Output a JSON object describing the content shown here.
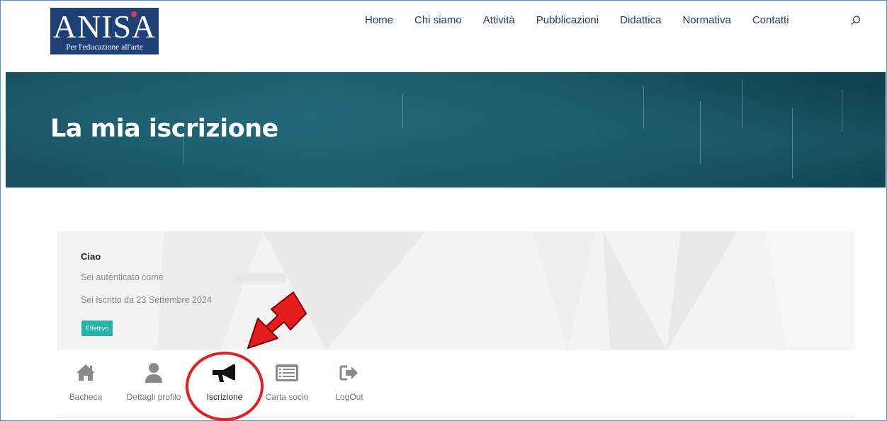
{
  "header": {
    "logo_text": "ANISA",
    "logo_tagline": "Per l'educazione all'arte",
    "nav": [
      "Home",
      "Chi siamo",
      "Attività",
      "Pubblicazioni",
      "Didattica",
      "Normativa",
      "Contatti"
    ]
  },
  "banner": {
    "title": "La mia iscrizione"
  },
  "account": {
    "greeting": "Ciao",
    "auth_text": "Sei autenticato come",
    "member_since": "Sei iscritto da 23 Settembre 2024",
    "status_badge": "Effettivo"
  },
  "tabs": [
    {
      "label": "Bacheca",
      "icon": "home-icon"
    },
    {
      "label": "Dettagli profilo",
      "icon": "user-icon"
    },
    {
      "label": "Iscrizione",
      "icon": "megaphone-icon",
      "active": true
    },
    {
      "label": "Carta socio",
      "icon": "card-list-icon"
    },
    {
      "label": "LogOut",
      "icon": "logout-icon"
    }
  ],
  "colors": {
    "brand_blue": "#1f3f78",
    "nav_text": "#243a6b",
    "banner_teal": "#1c6070",
    "badge_teal": "#22b3a9",
    "annotation_red": "#e41e1e"
  }
}
